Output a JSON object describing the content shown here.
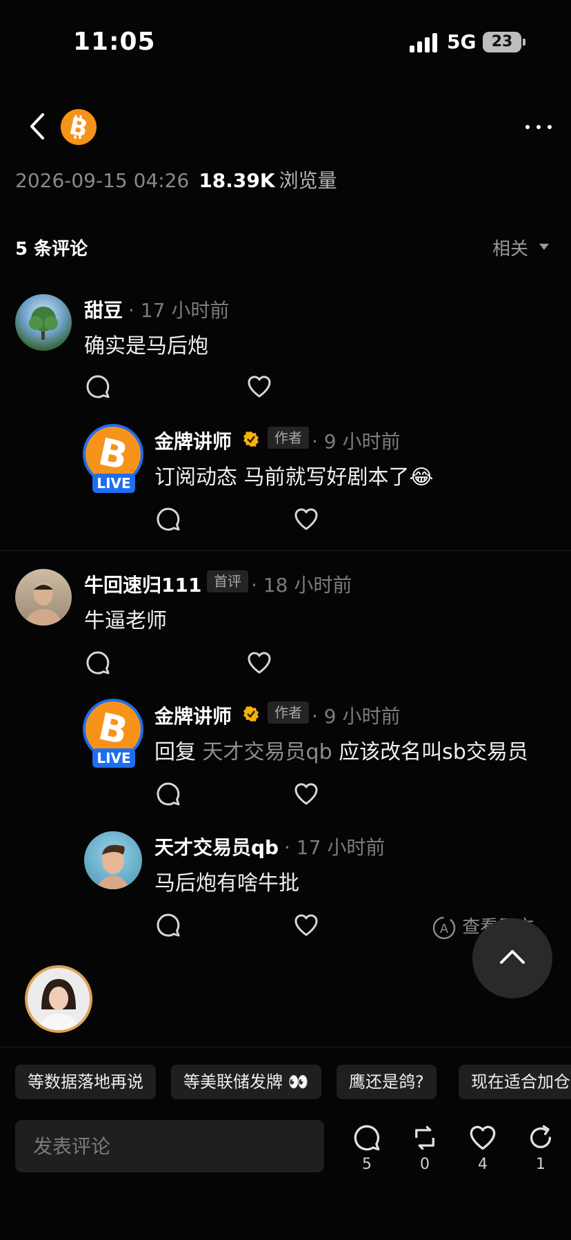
{
  "status_bar": {
    "time": "11:05",
    "network": "5G",
    "battery": "23"
  },
  "post_meta": {
    "date": "2026-09-15 04:26",
    "views": "18.39K",
    "views_label": "浏览量"
  },
  "comments_header": {
    "count_label": "5 条评论",
    "sort_label": "相关"
  },
  "comments": [
    {
      "author": "甜豆",
      "time": "· 17 小时前",
      "text": "确实是马后炮",
      "replies": [
        {
          "author": "金牌讲师",
          "tag": "作者",
          "time": "· 9 小时前",
          "text": "订阅动态 马前就写好剧本了😂",
          "live": "LIVE"
        }
      ]
    },
    {
      "author": "牛回速归111",
      "tag": "首评",
      "time": "· 18 小时前",
      "text": "牛逼老师",
      "replies": [
        {
          "author": "金牌讲师",
          "tag": "作者",
          "time": "· 9 小时前",
          "reply_prefix": "回复",
          "mention": "天才交易员qb",
          "text": "应该改名叫sb交易员",
          "live": "LIVE"
        },
        {
          "author": "天才交易员qb",
          "time": "· 17 小时前",
          "text": "马后炮有啥牛批",
          "translate": "查看原文"
        }
      ]
    }
  ],
  "quick_replies": [
    "等数据落地再说",
    "等美联储发牌 👀",
    "鹰还是鸽?",
    "现在适合加仓"
  ],
  "bottom_bar": {
    "input_placeholder": "发表评论",
    "comments": "5",
    "reposts": "0",
    "likes": "4",
    "shares": "1"
  },
  "colors": {
    "bitcoin": "#f7931a",
    "live": "#1e6ef0",
    "verified": "#f5b20a"
  },
  "icons": [
    "back-icon",
    "bitcoin-icon",
    "more-icon",
    "comment-icon",
    "heart-icon",
    "repost-icon",
    "share-icon",
    "translate-icon",
    "chevron-up-icon",
    "verified-icon"
  ]
}
